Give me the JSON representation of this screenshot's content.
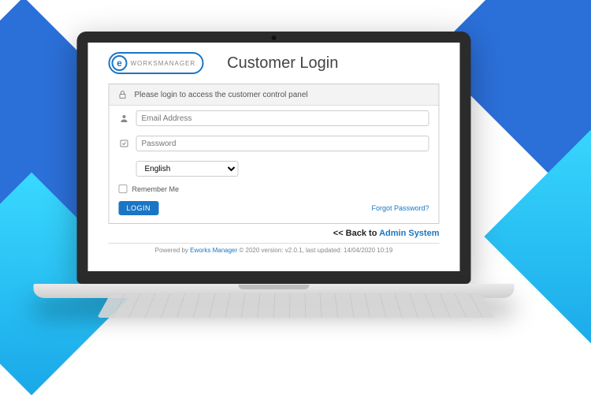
{
  "brand": {
    "initial": "e",
    "name": "WORKSMANAGER"
  },
  "header": {
    "title": "Customer Login"
  },
  "login": {
    "prompt": "Please login to access the customer control panel",
    "email_placeholder": "Email Address",
    "password_placeholder": "Password",
    "language_selected": "English",
    "remember_label": "Remember Me",
    "login_button": "LOGIN",
    "forgot_label": "Forgot Password?"
  },
  "back": {
    "prefix": "<< Back to ",
    "link": "Admin System"
  },
  "footer": {
    "prefix": "Powered by ",
    "brand_link": "Eworks Manager",
    "rest": " © 2020 version: v2.0.1, last updated: 14/04/2020 10:19"
  }
}
